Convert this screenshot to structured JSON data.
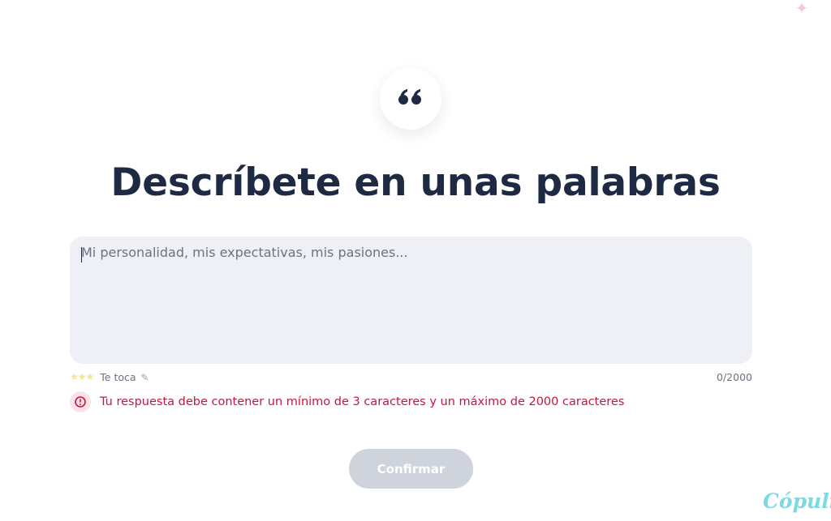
{
  "decor": {
    "sparkle_icon": "sparkle-icon",
    "quote_icon": "quote-icon"
  },
  "question": {
    "title": "Descríbete en unas palabras"
  },
  "answer": {
    "placeholder": "Mi personalidad, mis expectativas, mis pasiones...",
    "value": "",
    "hint_icons": [
      "star-icon",
      "star-icon",
      "star-icon"
    ],
    "hint_text": "Te toca",
    "hint_end_icon": "pencil-icon",
    "char_count": "0/2000",
    "max_chars": 2000
  },
  "validation": {
    "icon": "alert-circle-icon",
    "message": "Tu respuesta debe contener un mínimo de 3 caracteres y un máximo de 2000 caracteres"
  },
  "actions": {
    "confirm_label": "Confirmar",
    "confirm_enabled": false
  },
  "brand": {
    "logo_text": "Cópuli"
  },
  "colors": {
    "title": "#1e2a44",
    "error": "#c2183f",
    "button_disabled": "#cfd3dc",
    "input_bg": "#eef0f5",
    "brand": "#7dd9e3"
  }
}
